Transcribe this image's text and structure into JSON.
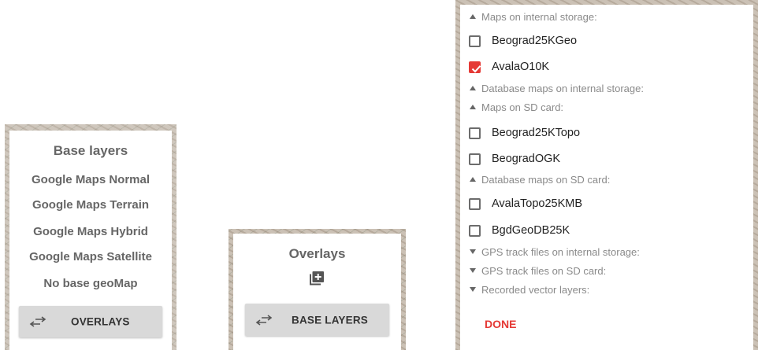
{
  "base_layers": {
    "title": "Base layers",
    "items": [
      "Google Maps Normal",
      "Google Maps Terrain",
      "Google Maps Hybrid",
      "Google Maps Satellite",
      "No base geoMap"
    ],
    "button": {
      "icon": "swap-arrows-icon",
      "label": "OVERLAYS"
    }
  },
  "overlays": {
    "title": "Overlays",
    "add_icon": "add-layer-icon",
    "button": {
      "icon": "swap-arrows-icon",
      "label": "BASE LAYERS"
    }
  },
  "maps": {
    "sections": [
      {
        "label": "Maps on internal storage:",
        "expanded": true,
        "items": [
          {
            "label": "Beograd25KGeo",
            "checked": false
          },
          {
            "label": "AvalaO10K",
            "checked": true
          }
        ]
      },
      {
        "label": "Database maps on internal storage:",
        "expanded": true,
        "items": []
      },
      {
        "label": "Maps on SD card:",
        "expanded": true,
        "items": [
          {
            "label": "Beograd25KTopo",
            "checked": false
          },
          {
            "label": "BeogradOGK",
            "checked": false
          }
        ]
      },
      {
        "label": "Database maps on SD card:",
        "expanded": true,
        "items": [
          {
            "label": "AvalaTopo25KMB",
            "checked": false
          },
          {
            "label": "BgdGeoDB25K",
            "checked": false
          }
        ]
      },
      {
        "label": "GPS track files on internal storage:",
        "expanded": false,
        "items": []
      },
      {
        "label": "GPS track files on SD card:",
        "expanded": false,
        "items": []
      },
      {
        "label": "Recorded vector layers:",
        "expanded": false,
        "items": []
      }
    ],
    "done_label": "DONE"
  },
  "colors": {
    "accent": "#e53935",
    "button_bg": "#d9d9d9",
    "text_muted": "#666666"
  }
}
